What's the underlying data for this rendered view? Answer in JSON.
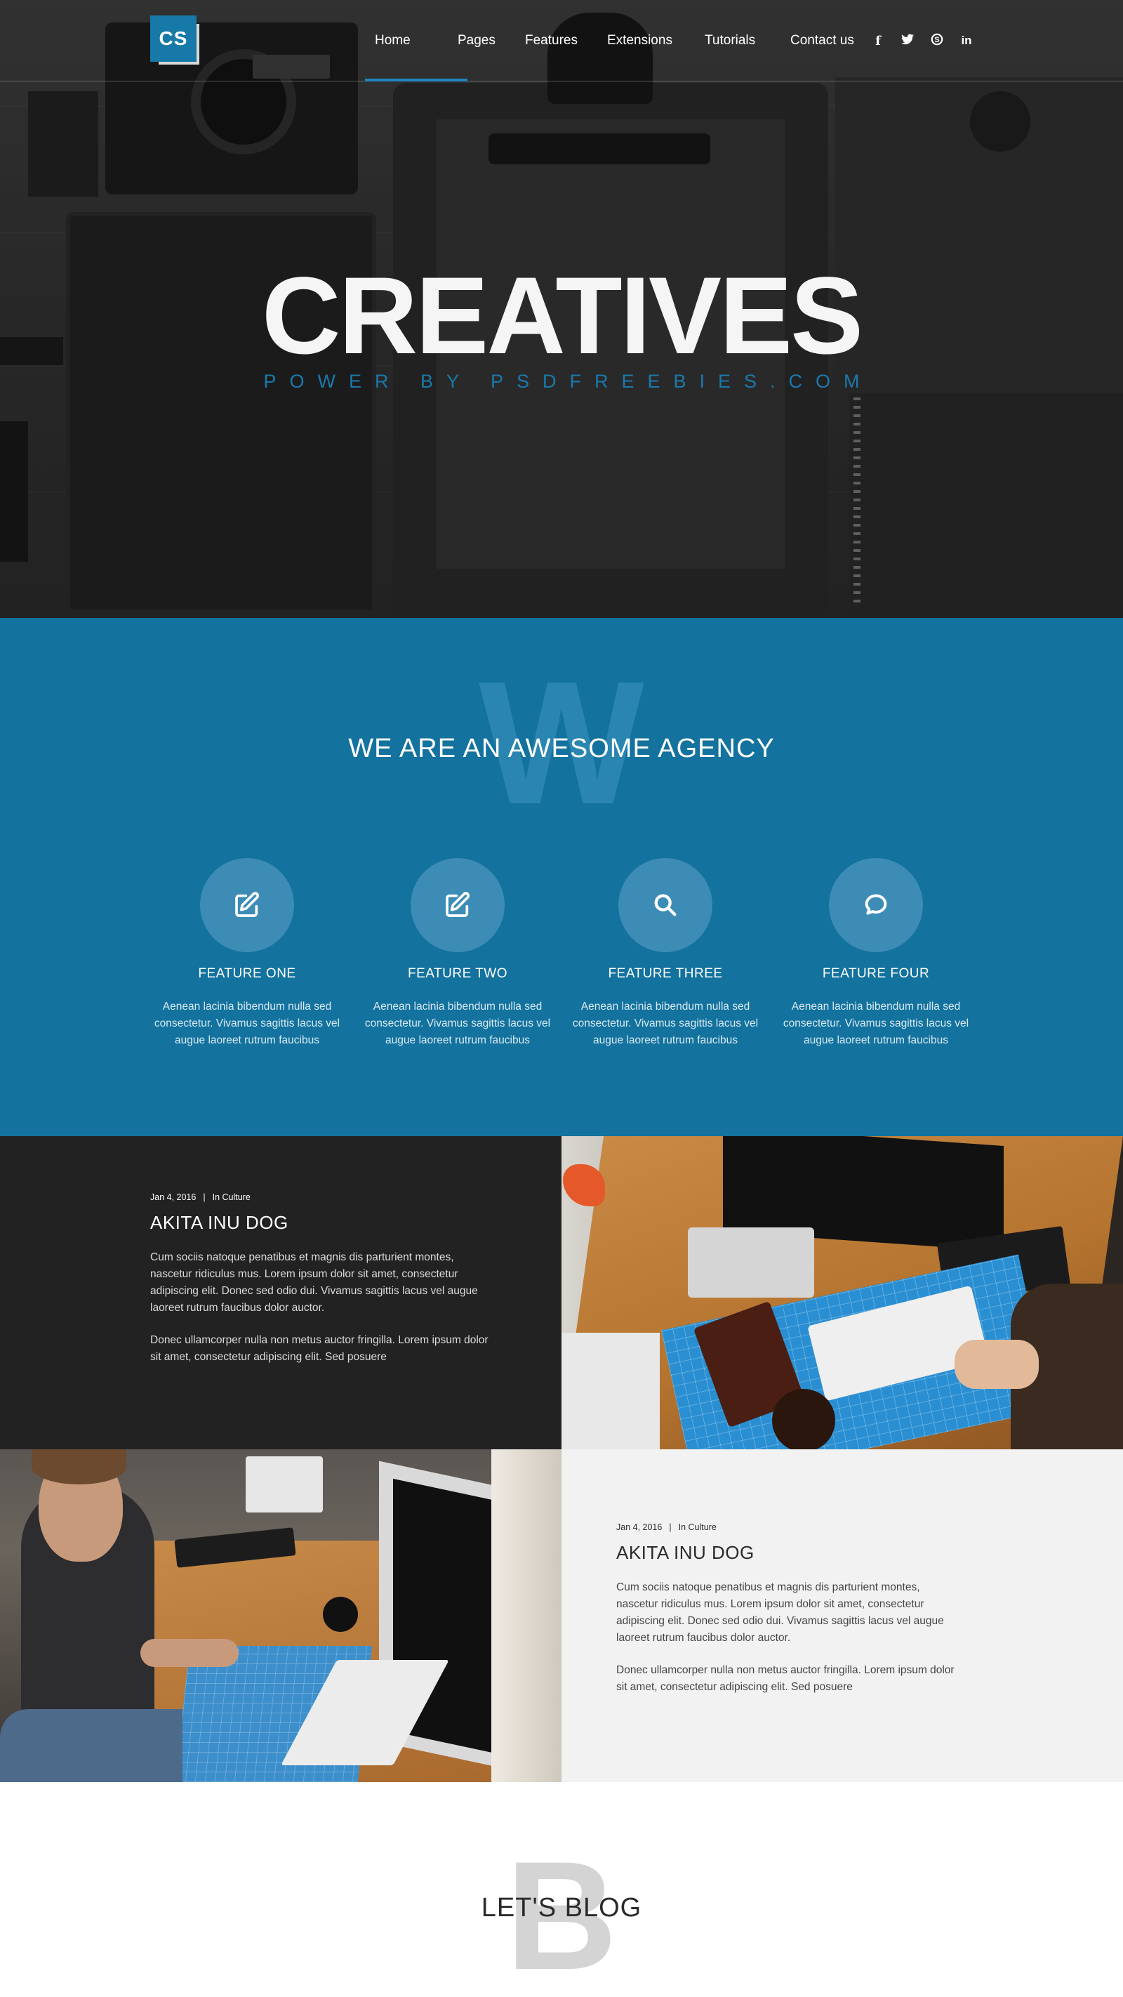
{
  "header": {
    "logo_text": "CS",
    "nav": [
      "Home",
      "Pages",
      "Features",
      "Extensions",
      "Tutorials",
      "Contact us"
    ],
    "active_nav": "Home",
    "social_icons": [
      "facebook-icon",
      "twitter-icon",
      "skype-icon",
      "linkedin-icon"
    ]
  },
  "hero": {
    "title": "CREATIVES",
    "subtitle": "POWER BY PSDFREEBIES.COM"
  },
  "agency": {
    "watermark": "W",
    "heading": "WE ARE AN AWESOME AGENCY",
    "features": [
      {
        "icon": "edit-icon",
        "title": "FEATURE ONE",
        "text": "Aenean lacinia bibendum nulla sed consectetur. Vivamus sagittis lacus vel augue laoreet rutrum faucibus"
      },
      {
        "icon": "edit-icon",
        "title": "FEATURE TWO",
        "text": "Aenean lacinia bibendum nulla sed consectetur. Vivamus sagittis lacus vel augue laoreet rutrum faucibus"
      },
      {
        "icon": "search-icon",
        "title": "FEATURE THREE",
        "text": "Aenean lacinia bibendum nulla sed consectetur. Vivamus sagittis lacus vel augue laoreet rutrum faucibus"
      },
      {
        "icon": "chat-icon",
        "title": "FEATURE FOUR",
        "text": "Aenean lacinia bibendum nulla sed consectetur. Vivamus sagittis lacus vel augue laoreet rutrum faucibus"
      }
    ]
  },
  "posts": [
    {
      "date": "Jan 4, 2016",
      "category": "In Culture",
      "title": "AKITA INU DOG",
      "paragraphs": [
        "Cum sociis natoque penatibus et magnis dis parturient montes, nascetur ridiculus mus. Lorem ipsum dolor sit amet, consectetur adipiscing elit. Donec sed odio dui. Vivamus sagittis lacus vel augue laoreet rutrum faucibus dolor auctor.",
        "Donec ullamcorper nulla non metus auctor fringilla. Lorem ipsum dolor sit amet, consectetur adipiscing elit. Sed posuere"
      ]
    },
    {
      "date": "Jan 4, 2016",
      "category": "In Culture",
      "title": "AKITA INU DOG",
      "paragraphs": [
        "Cum sociis natoque penatibus et magnis dis parturient montes, nascetur ridiculus mus. Lorem ipsum dolor sit amet, consectetur adipiscing elit. Donec sed odio dui. Vivamus sagittis lacus vel augue laoreet rutrum faucibus dolor auctor.",
        "Donec ullamcorper nulla non metus auctor fringilla. Lorem ipsum dolor sit amet, consectetur adipiscing elit. Sed posuere"
      ]
    }
  ],
  "blog": {
    "watermark": "B",
    "heading": "LET'S BLOG"
  },
  "colors": {
    "brand_blue": "#13729e",
    "accent_blue": "#1e88c0",
    "dark_panel": "#222222",
    "light_panel": "#f2f2f2"
  }
}
